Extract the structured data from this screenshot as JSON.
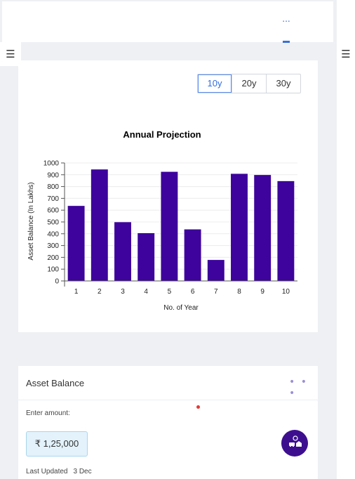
{
  "header": {
    "more_label": "..."
  },
  "range_tabs": [
    {
      "label": "10y",
      "active": true
    },
    {
      "label": "20y",
      "active": false
    },
    {
      "label": "30y",
      "active": false
    }
  ],
  "chart_data": {
    "type": "bar",
    "title": "Annual Projection",
    "xlabel": "No. of Year",
    "ylabel": "Asset Balance (In Lakhs)",
    "categories": [
      "1",
      "2",
      "3",
      "4",
      "5",
      "6",
      "7",
      "8",
      "9",
      "10"
    ],
    "values": [
      636,
      945,
      498,
      405,
      925,
      437,
      178,
      908,
      898,
      846
    ],
    "ylim": [
      0,
      1000
    ],
    "yticks": [
      0,
      100,
      200,
      300,
      400,
      500,
      600,
      700,
      800,
      900,
      1000
    ],
    "grid": true,
    "bar_color": "#3d039c"
  },
  "asset_card": {
    "title": "Asset Balance",
    "more_label": "• • •",
    "enter_label": "Enter amount:",
    "amount": "₹ 1,25,000",
    "last_updated_label": "Last Updated",
    "last_updated_value": "3 Dec"
  },
  "colors": {
    "accent": "#2f6de1",
    "bar": "#3d039c",
    "fab": "#3d0f8f"
  }
}
